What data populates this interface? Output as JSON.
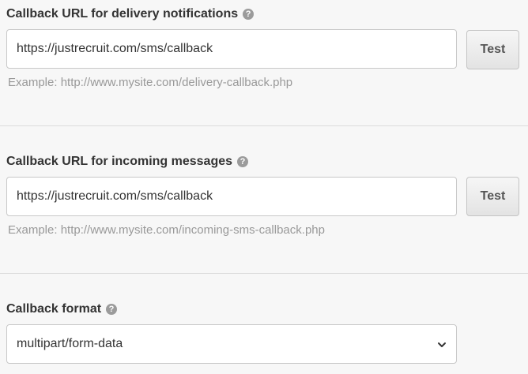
{
  "delivery": {
    "label": "Callback URL for delivery notifications",
    "help_icon": "question-circle-icon",
    "value": "https://justrecruit.com/sms/callback",
    "button_label": "Test",
    "hint": "Example: http://www.mysite.com/delivery-callback.php"
  },
  "incoming": {
    "label": "Callback URL for incoming messages",
    "help_icon": "question-circle-icon",
    "value": "https://justrecruit.com/sms/callback",
    "button_label": "Test",
    "hint": "Example: http://www.mysite.com/incoming-sms-callback.php"
  },
  "format": {
    "label": "Callback format",
    "help_icon": "question-circle-icon",
    "selected": "multipart/form-data",
    "dropdown_icon": "chevron-down-icon"
  },
  "help_glyph": "?"
}
